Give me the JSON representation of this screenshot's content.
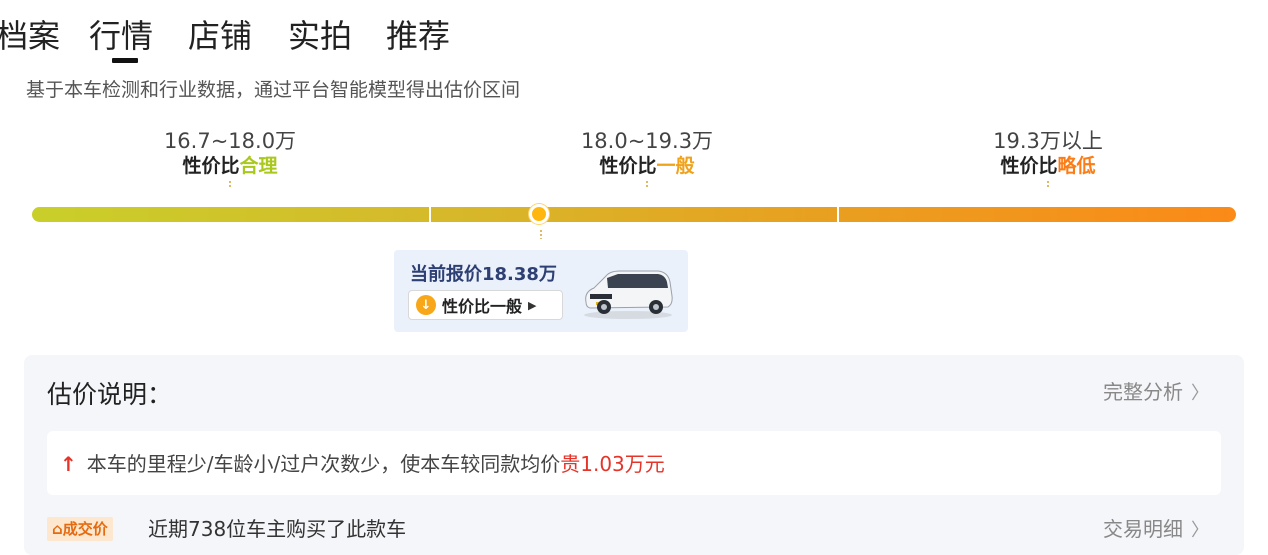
{
  "tabs": [
    "档案",
    "行情",
    "店铺",
    "实拍",
    "推荐"
  ],
  "active_tab": "行情",
  "description": "基于本车检测和行业数据，通过平台智能模型得出估价区间",
  "ranges": [
    {
      "range": "16.7~18.0万",
      "prefix": "性价比",
      "grade": "合理",
      "grade_color": "#a9c81c"
    },
    {
      "range": "18.0~19.3万",
      "prefix": "性价比",
      "grade": "一般",
      "grade_color": "#f0a21a"
    },
    {
      "range": "19.3万以上",
      "prefix": "性价比",
      "grade": "略低",
      "grade_color": "#fb7d17"
    }
  ],
  "current": {
    "label": "当前报价18.38万",
    "value_label": "性价比一般"
  },
  "panel": {
    "title": "估价说明：",
    "full_analysis": "完整分析",
    "note_prefix": "本车的里程少/车龄小/过户次数少，使本车较同款均价",
    "note_highlight": "贵1.03万元",
    "deal_tag": "成交价",
    "deal_text": "近期738位车主购买了此款车",
    "deal_link": "交易明细"
  },
  "colors": {
    "accent": "#ffb70f",
    "warning_red": "#e5352b"
  }
}
